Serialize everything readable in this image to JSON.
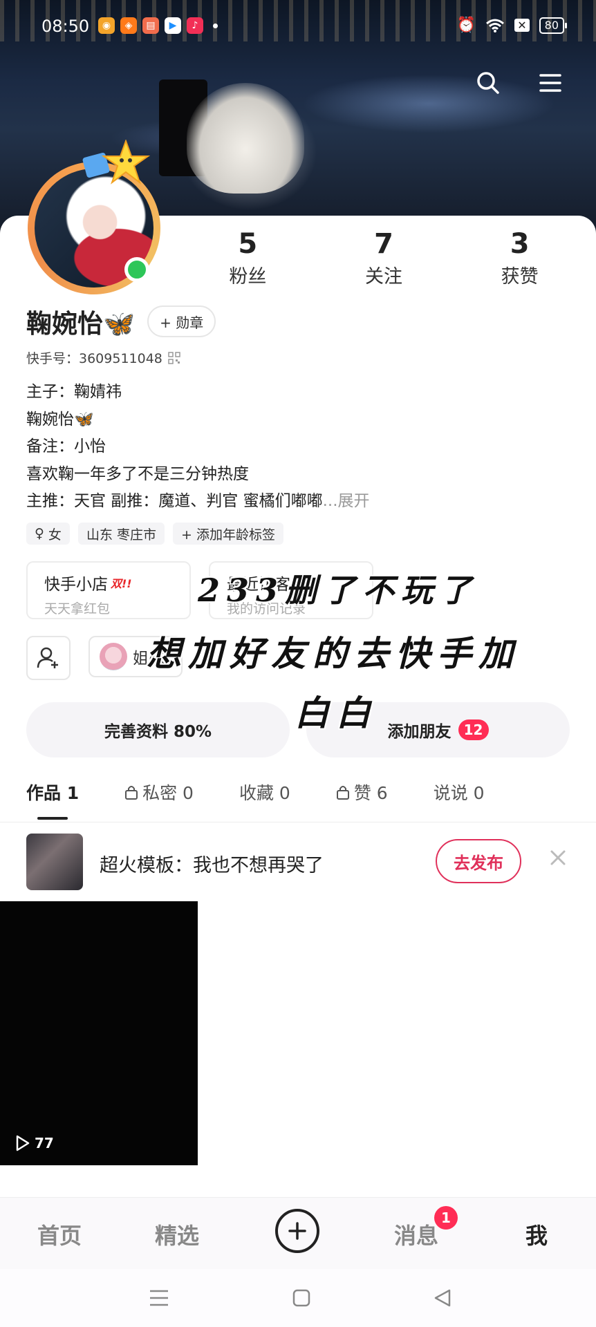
{
  "status_bar": {
    "time": "08:50",
    "battery": "80",
    "notification_icons": [
      "weibo-icon",
      "app-orange-icon",
      "app-red-icon",
      "video-app-icon",
      "music-app-icon"
    ]
  },
  "header": {
    "search_icon": "search-icon",
    "menu_icon": "menu-icon"
  },
  "profile": {
    "stats": [
      {
        "value": "5",
        "label": "粉丝"
      },
      {
        "value": "7",
        "label": "关注"
      },
      {
        "value": "3",
        "label": "获赞"
      }
    ],
    "name": "鞠婉怡🦋",
    "badge_button": "+ 勋章",
    "kuaishou_id": "快手号：3609511048",
    "bio_lines": [
      "主子：鞠婧祎",
      "鞠婉怡🦋",
      "备注：小怡",
      "喜欢鞠一年多了不是三分钟热度",
      "主推：天官 副推：魔道、判官 蜜橘们嘟嘟"
    ],
    "bio_more": "...展开",
    "tags": [
      "女",
      "山东 枣庄市",
      "+ 添加年龄标签"
    ],
    "gender_symbol": "♀"
  },
  "boxes": [
    {
      "title": "快手小店",
      "hot": "双!!",
      "subtitle": "天天拿红包"
    },
    {
      "title": "最近访客人",
      "subtitle": "我的访问记录"
    }
  ],
  "friend_chip": {
    "label": "姐妹"
  },
  "actions": {
    "complete_profile": "完善资料 80%",
    "add_friends": "添加朋友",
    "add_friends_count": "12"
  },
  "tabs": [
    {
      "label": "作品 1",
      "locked": false
    },
    {
      "label": "私密 0",
      "locked": true
    },
    {
      "label": "收藏 0",
      "locked": false
    },
    {
      "label": "赞 6",
      "locked": true
    },
    {
      "label": "说说 0",
      "locked": false
    }
  ],
  "promo": {
    "text": "超火模板：我也不想再哭了",
    "button": "去发布"
  },
  "video": {
    "plays": "77"
  },
  "overlay": {
    "line1": "233删了不玩了",
    "line2": "想加好友的去快手加",
    "line3": "白白"
  },
  "bottom_nav": {
    "items": [
      "首页",
      "精选",
      "消息",
      "我"
    ],
    "message_badge": "1"
  },
  "colors": {
    "accent": "#ff2d55",
    "publish": "#e0305a",
    "online": "#2dc658"
  }
}
